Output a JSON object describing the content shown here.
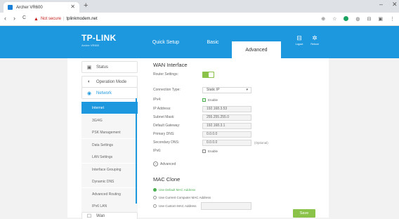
{
  "browser": {
    "tab_title": "Archer VR600",
    "tab_close": "✕",
    "new_tab": "+",
    "minimize": "–",
    "close": "✕",
    "back": "‹",
    "forward": "›",
    "reload": "C",
    "warning": "▲",
    "not_secure": "Not secure",
    "url": "tplinkmodem.net"
  },
  "header": {
    "logo": "TP-LINK",
    "model": "Archer VR600",
    "tabs": [
      {
        "label": "Quick Setup"
      },
      {
        "label": "Basic"
      },
      {
        "label": "Advanced"
      }
    ],
    "logout": "Logout",
    "reboot": "Reboot"
  },
  "sidebar": {
    "items": [
      {
        "label": "Status",
        "icon": "▣"
      },
      {
        "label": "Operation Mode",
        "icon": "◐"
      },
      {
        "label": "Network",
        "icon": "◉"
      }
    ],
    "subitems": [
      {
        "label": "Internet"
      },
      {
        "label": "3G/4G"
      },
      {
        "label": "PSK Management"
      },
      {
        "label": "Data Settings"
      },
      {
        "label": "LAN Settings"
      },
      {
        "label": "Interface Grouping"
      },
      {
        "label": "Dynamic DNS"
      },
      {
        "label": "Advanced Routing"
      },
      {
        "label": "IPv6 LAN"
      }
    ],
    "bottom_item": {
      "label": "Wan",
      "icon": "☐"
    }
  },
  "wan": {
    "title": "WAN Interface",
    "router_settings_label": "Router Settings:",
    "connection_type_label": "Connection Type:",
    "connection_type_value": "Static IP",
    "ipv4_label": "IPv4:",
    "ipv4_check": "Enable",
    "ip_label": "IP Address:",
    "ip_value": "192.168.3.53",
    "subnet_label": "Subnet Mask:",
    "subnet_value": "255.255.255.0",
    "gateway_label": "Default Gateway:",
    "gateway_value": "192.168.3.1",
    "dns1_label": "Primary DNS:",
    "dns1_value": "0.0.0.0",
    "dns2_label": "Secondary DNS:",
    "dns2_value": "0.0.0.0",
    "optional": "(Optional)",
    "ipv6_label": "IPv6:",
    "ipv6_check": "Enable",
    "advanced": "Advanced"
  },
  "mac": {
    "title": "MAC Clone",
    "opt1": "Use Default MAC Address",
    "opt2": "Use Current Computer MAC Address",
    "opt3": "Use Custom MAC Address"
  },
  "save_label": "Save",
  "colors": {
    "brand": "#1d98df",
    "accent": "#8bc34a"
  }
}
